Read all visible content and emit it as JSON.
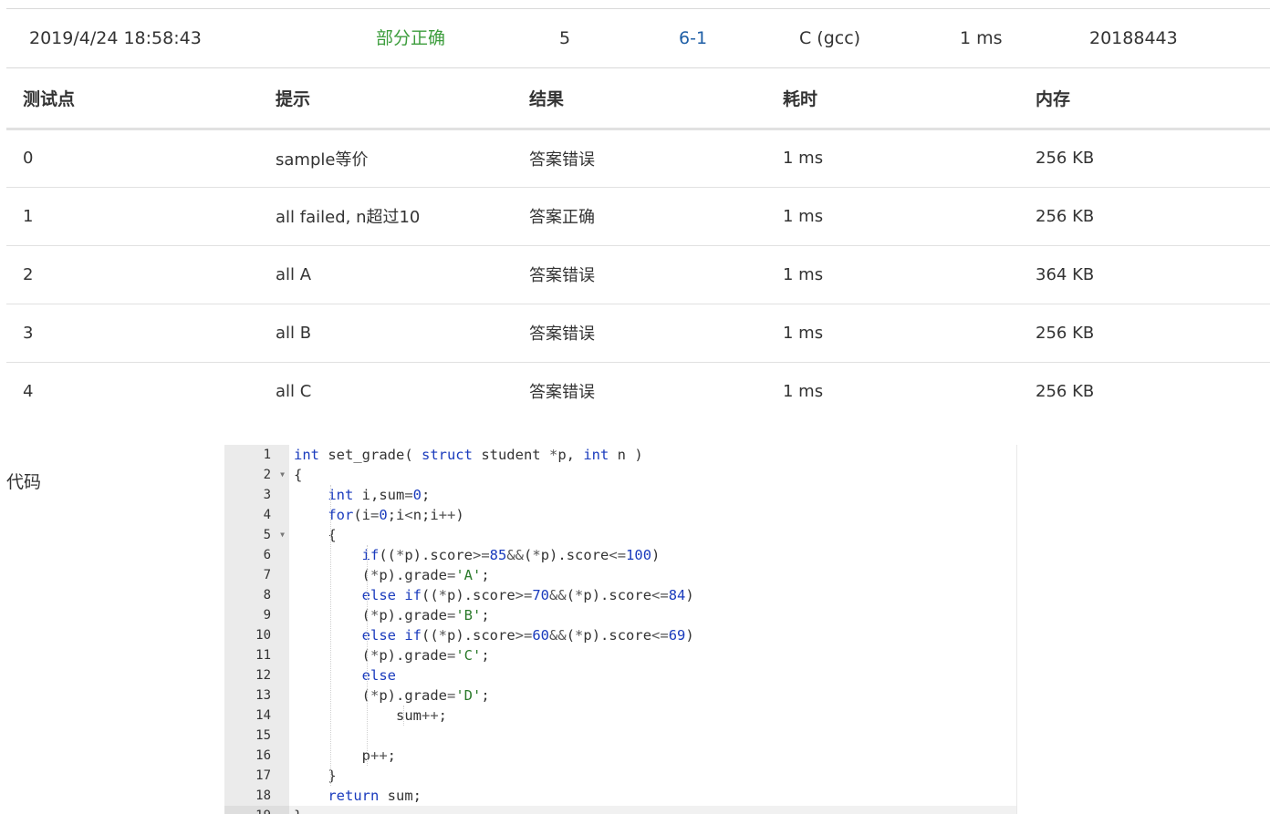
{
  "submission": {
    "time": "2019/4/24 18:58:43",
    "status": "部分正确",
    "score": "5",
    "problem": "6-1",
    "language": "C (gcc)",
    "duration": "1 ms",
    "user": "20188443"
  },
  "cases_table": {
    "headers": [
      "测试点",
      "提示",
      "结果",
      "耗时",
      "内存"
    ],
    "rows": [
      {
        "id": "0",
        "hint": "sample等价",
        "result": "答案错误",
        "time": "1 ms",
        "memory": "256 KB"
      },
      {
        "id": "1",
        "hint": "all failed, n超过10",
        "result": "答案正确",
        "time": "1 ms",
        "memory": "256 KB"
      },
      {
        "id": "2",
        "hint": "all A",
        "result": "答案错误",
        "time": "1 ms",
        "memory": "364 KB"
      },
      {
        "id": "3",
        "hint": "all B",
        "result": "答案错误",
        "time": "1 ms",
        "memory": "256 KB"
      },
      {
        "id": "4",
        "hint": "all C",
        "result": "答案错误",
        "time": "1 ms",
        "memory": "256 KB"
      }
    ]
  },
  "code_label": "代码",
  "code": {
    "lines": [
      "int set_grade( struct student *p, int n )",
      "{",
      "    int i,sum=0;",
      "    for(i=0;i<n;i++)",
      "    {",
      "        if((*p).score>=85&&(*p).score<=100)",
      "        (*p).grade='A';",
      "        else if((*p).score>=70&&(*p).score<=84)",
      "        (*p).grade='B';",
      "        else if((*p).score>=60&&(*p).score<=69)",
      "        (*p).grade='C';",
      "        else",
      "        (*p).grade='D';",
      "            sum++;",
      "",
      "        p++;",
      "    }",
      "    return sum;",
      "}"
    ],
    "fold_lines": [
      2,
      5
    ]
  },
  "colors": {
    "status_partial": "#3c9d3c",
    "result_wrong": "#3c9d3c",
    "result_correct": "#d9413a",
    "link": "#1f5fa6",
    "keyword": "#1a3bbd",
    "string": "#2b7a2b"
  },
  "icons": {
    "fold": "chevron-down-icon"
  }
}
